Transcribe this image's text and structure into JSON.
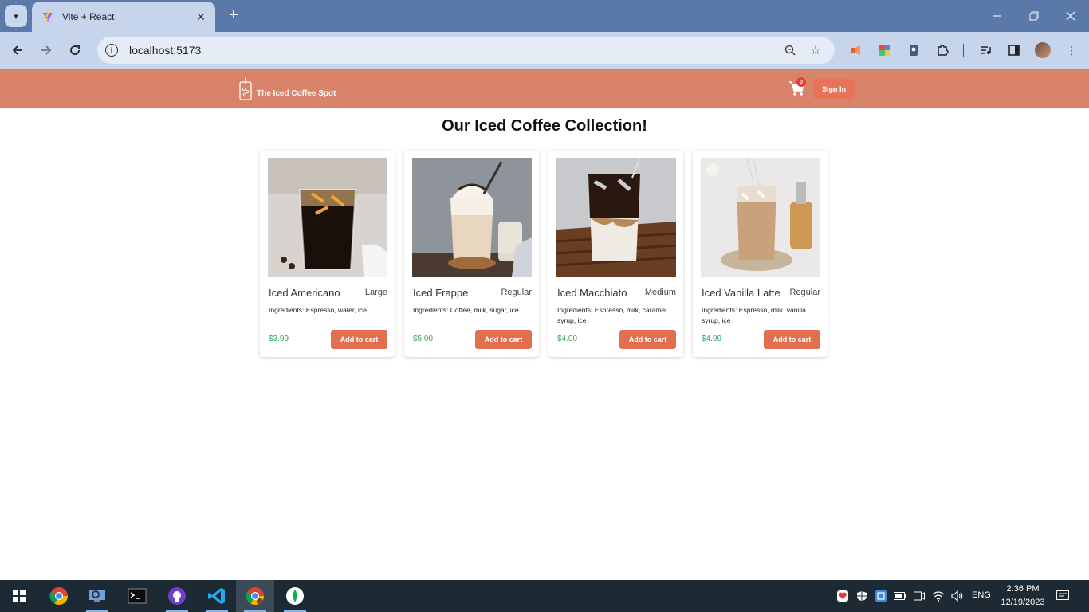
{
  "browser": {
    "tab_title": "Vite + React",
    "url": "localhost:5173",
    "new_tab_label": "+",
    "tab_close_label": "✕"
  },
  "app": {
    "brand": "The Iced Coffee Spot",
    "cart_count": "0",
    "sign_in_label": "Sign In",
    "page_title": "Our Iced Coffee Collection!",
    "accent_color": "#d9836a",
    "button_color": "#e16e4f",
    "price_color": "#3aa56a"
  },
  "products": [
    {
      "name": "Iced Americano",
      "size": "Large",
      "ingredients": "Ingredients: Espresso, water, ice",
      "price": "$3.99",
      "button_label": "Add to cart"
    },
    {
      "name": "Iced Frappe",
      "size": "Regular",
      "ingredients": "Ingredients: Coffee, milk, sugar, ice",
      "price": "$5.00",
      "button_label": "Add to cart"
    },
    {
      "name": "Iced Macchiato",
      "size": "Medium",
      "ingredients": "Ingredients: Espresso, milk, caramel syrup, ice",
      "price": "$4.00",
      "button_label": "Add to cart"
    },
    {
      "name": "Iced Vanilla Latte",
      "size": "Regular",
      "ingredients": "Ingredients: Espresso, milk, vanilla syrup, ice",
      "price": "$4.99",
      "button_label": "Add to cart"
    }
  ],
  "taskbar": {
    "lang": "ENG",
    "time": "2:36 PM",
    "date": "12/19/2023"
  }
}
